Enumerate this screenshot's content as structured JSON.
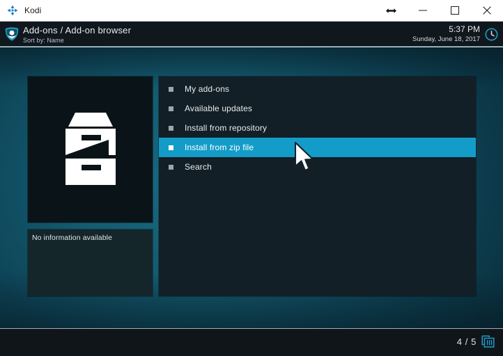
{
  "window": {
    "title": "Kodi",
    "app_icon": "kodi-logo-icon",
    "controls": {
      "resize": "resize-horizontal-icon",
      "minimize": "minimize-button",
      "maximize": "maximize-button",
      "close": "close-button"
    }
  },
  "header": {
    "logo_icon": "kodi-addons-shield-icon",
    "title": "Add-ons / Add-on browser",
    "subtitle": "Sort by: Name",
    "time": "5:37 PM",
    "date": "Sunday, June 18, 2017",
    "clock_icon": "clock-icon"
  },
  "left": {
    "thumbnail_icon": "file-cabinet-archive-icon",
    "info_text": "No information available"
  },
  "list": {
    "items": [
      {
        "label": "My add-ons",
        "selected": false
      },
      {
        "label": "Available updates",
        "selected": false
      },
      {
        "label": "Install from repository",
        "selected": false
      },
      {
        "label": "Install from zip file",
        "selected": true
      },
      {
        "label": "Search",
        "selected": false
      }
    ]
  },
  "footer": {
    "pager": "4 / 5",
    "view_icon": "list-view-icon"
  },
  "colors": {
    "accent": "#149cc9",
    "panel": "#131f26",
    "header_bg": "#10181e",
    "background_teal": "#135b70",
    "footer_bg": "#0f1519"
  }
}
